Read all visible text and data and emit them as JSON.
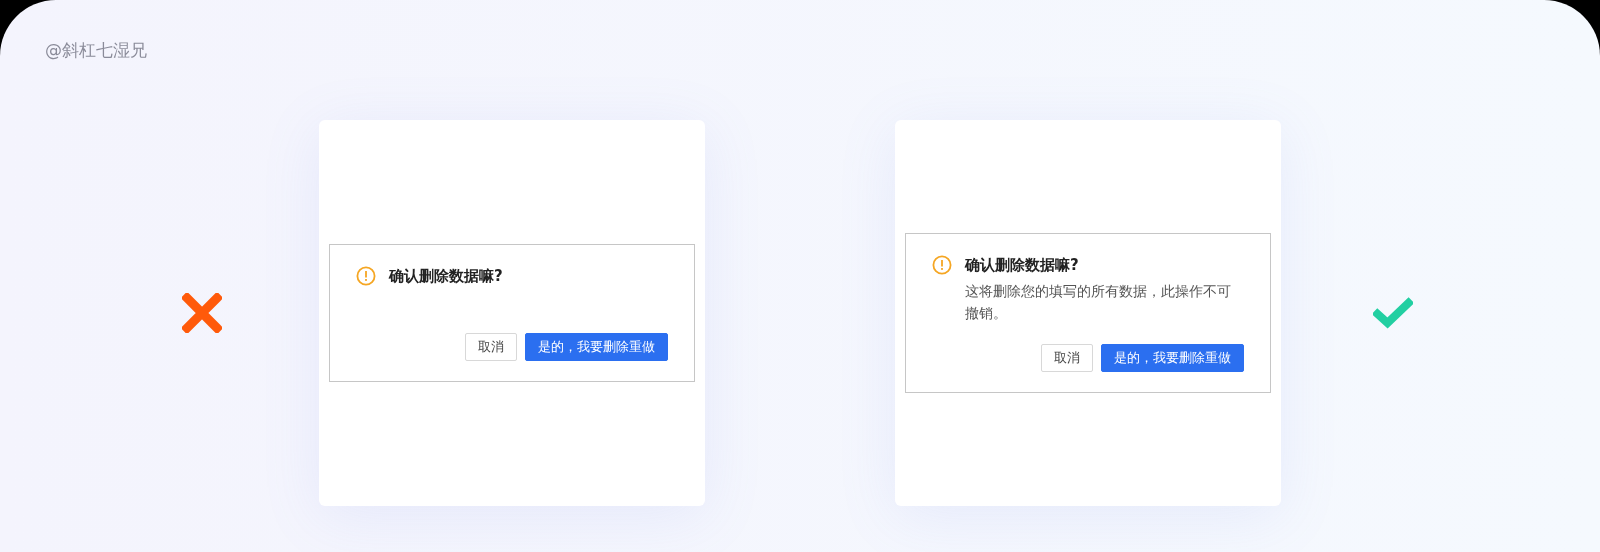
{
  "author_tag": "@斜杠七湿兄",
  "examples": [
    {
      "kind": "wrong",
      "dialog": {
        "title": "确认删除数据嘛?",
        "buttons": [
          {
            "label": "取消",
            "kind": "secondary"
          },
          {
            "label": "是的，我要删除重做",
            "kind": "primary"
          }
        ]
      }
    },
    {
      "kind": "right",
      "dialog": {
        "title": "确认删除数据嘛?",
        "description": "这将删除您的填写的所有数据，此操作不可撤销。",
        "buttons": [
          {
            "label": "取消",
            "kind": "secondary"
          },
          {
            "label": "是的，我要删除重做",
            "kind": "primary"
          }
        ]
      }
    }
  ]
}
